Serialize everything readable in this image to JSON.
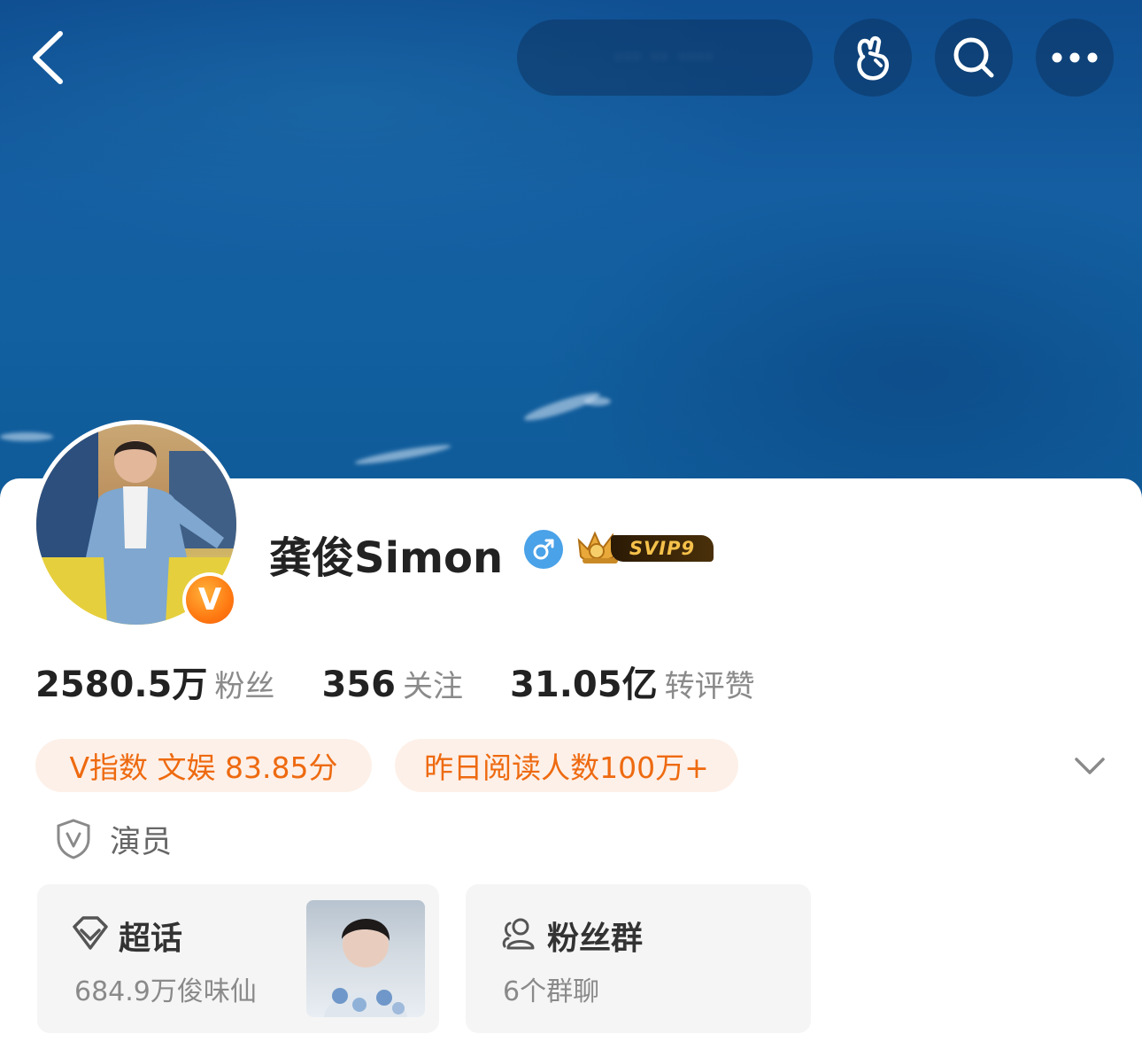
{
  "header": {
    "blurred_title": "··· ·· ····"
  },
  "profile": {
    "name": "龚俊Simon",
    "gender": "male",
    "vip_label": "SVIP9",
    "verified_badge": "V"
  },
  "stats": [
    {
      "value": "2580.5万",
      "label": "粉丝"
    },
    {
      "value": "356",
      "label": "关注"
    },
    {
      "value": "31.05亿",
      "label": "转评赞"
    }
  ],
  "tags": [
    {
      "text": "V指数 文娱 83.85分"
    },
    {
      "text": "昨日阅读人数100万+"
    }
  ],
  "occupation": "演员",
  "tiles": {
    "supertopic": {
      "title": "超话",
      "subtitle": "684.9万俊味仙"
    },
    "fan_group": {
      "title": "粉丝群",
      "subtitle": "6个群聊"
    }
  },
  "colors": {
    "banner": "#145ea1",
    "tag_bg": "#fdf0e8",
    "tag_text": "#ee6a10",
    "verified_orange": "#ff7a12",
    "gender_blue": "#4aa2e8"
  }
}
